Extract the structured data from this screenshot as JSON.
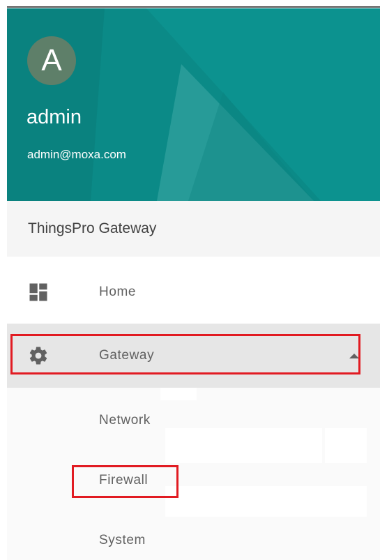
{
  "user": {
    "avatar_letter": "A",
    "name": "admin",
    "email": "admin@moxa.com"
  },
  "app": {
    "title": "ThingsPro Gateway"
  },
  "nav": {
    "home": {
      "label": "Home",
      "icon": "dashboard-icon"
    },
    "gateway": {
      "label": "Gateway",
      "icon": "gear-icon",
      "expanded": true,
      "children": [
        {
          "label": "Network"
        },
        {
          "label": "Firewall"
        },
        {
          "label": "System"
        }
      ]
    }
  },
  "colors": {
    "header_bg": "#0b8a87",
    "avatar_bg": "#5e7f69",
    "highlight": "#e11b22",
    "selected_bg": "#e6e6e6"
  }
}
